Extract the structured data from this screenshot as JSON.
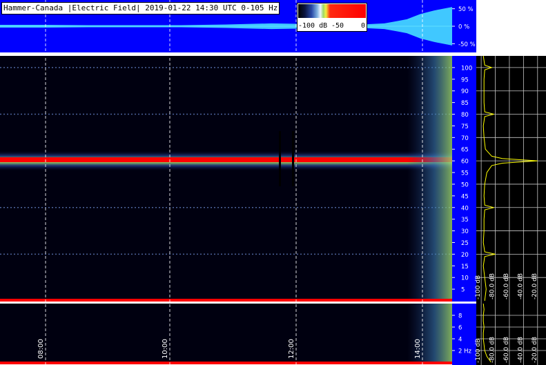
{
  "window": {
    "title": "Hammer-Canada |Electric Field| 2019-01-22 14:30 UTC 0-105 Hz"
  },
  "colorbar": {
    "ticks": [
      "-100 dB",
      "-50",
      "0"
    ]
  },
  "colors": {
    "background": "#000000",
    "waveform_bg": "#0000ff",
    "waveform": "#40c8ff",
    "spectrum_line": "#ffff00",
    "line_60hz": "#ff0000",
    "grid": "#ffffff"
  },
  "chart_data": [
    {
      "type": "area",
      "panel": "waveform",
      "yticks": [
        50,
        0,
        -50
      ],
      "ytick_labels": [
        "50 %",
        "0 %",
        "-50 %"
      ],
      "ylim": [
        -75,
        75
      ],
      "envelope": {
        "x": [
          0,
          0.1,
          0.2,
          0.3,
          0.4,
          0.5,
          0.6,
          0.7,
          0.8,
          0.85,
          0.88,
          0.9,
          0.93,
          0.96,
          1.0
        ],
        "amplitude": [
          4,
          4,
          3,
          3,
          3,
          5,
          8,
          6,
          5,
          8,
          15,
          20,
          35,
          45,
          55
        ]
      }
    },
    {
      "type": "heatmap",
      "panel": "spectrogram",
      "ylabel": "Hz",
      "ylim": [
        0,
        105
      ],
      "yticks": [
        5,
        10,
        15,
        20,
        25,
        30,
        35,
        40,
        45,
        50,
        55,
        60,
        65,
        70,
        75,
        80,
        85,
        90,
        95,
        100
      ],
      "time_ticks": [
        "08:00",
        "10:00",
        "12:00",
        "14:00"
      ],
      "bright_lines_hz": [
        60,
        20,
        40,
        80,
        100
      ],
      "colorbar_db": [
        -100,
        -50,
        0
      ]
    },
    {
      "type": "heatmap",
      "panel": "low-frequency",
      "yticks": [
        2,
        4,
        6,
        8
      ],
      "ytick_labels": [
        "2 Hz",
        "4",
        "6",
        "8"
      ],
      "ylim": [
        0,
        10
      ]
    },
    {
      "type": "line",
      "panel": "spectrum",
      "xticks_db": [
        -100,
        -80,
        -60,
        -40,
        -20
      ],
      "xtick_labels": [
        "-100 dB",
        "-80.0 dB",
        "-60.0 dB",
        "-40.0 dB",
        "-20.0 dB"
      ],
      "xlim_db": [
        -105,
        -10
      ],
      "freq_hz": [
        0,
        5,
        10,
        15,
        19,
        20,
        21,
        25,
        30,
        35,
        39,
        40,
        41,
        45,
        50,
        55,
        58,
        59,
        60,
        61,
        62,
        65,
        70,
        75,
        79,
        80,
        81,
        85,
        90,
        95,
        99,
        100,
        101,
        105
      ],
      "level_db": [
        -95,
        -93,
        -95,
        -97,
        -95,
        -80,
        -95,
        -97,
        -96,
        -96,
        -95,
        -82,
        -95,
        -96,
        -95,
        -92,
        -85,
        -70,
        -20,
        -70,
        -85,
        -94,
        -96,
        -97,
        -95,
        -82,
        -95,
        -96,
        -96,
        -96,
        -95,
        -85,
        -95,
        -97
      ]
    },
    {
      "type": "line",
      "panel": "spectrum-low",
      "freq_hz": [
        0,
        1,
        2,
        3,
        4,
        5,
        6,
        7,
        8,
        9,
        10
      ],
      "level_db": [
        -86,
        -92,
        -95,
        -96,
        -97,
        -97,
        -96,
        -97,
        -97,
        -96,
        -97
      ]
    }
  ]
}
